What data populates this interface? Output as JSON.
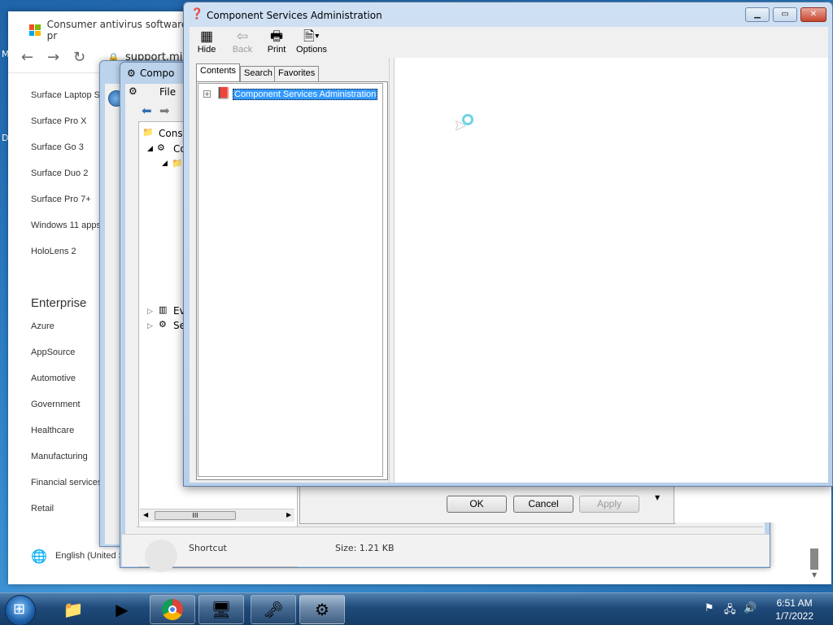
{
  "browser": {
    "tab_title": "Consumer antivirus software pr",
    "address": "support.mi",
    "side_links": [
      "Surface Laptop St",
      "Surface Pro X",
      "Surface Go 3",
      "Surface Duo 2",
      "Surface Pro 7+",
      "Windows 11 apps",
      "HoloLens 2"
    ],
    "enterprise_heading": "Enterprise",
    "enterprise_links": [
      "Azure",
      "AppSource",
      "Automotive",
      "Government",
      "Healthcare",
      "Manufacturing",
      "Financial services",
      "Retail"
    ],
    "language": "English (United S",
    "footer_shortcut": "Shortcut",
    "footer_size": "Size: 1.21 KB"
  },
  "desktop": {
    "left_letter_1": "M",
    "left_letter_2": "D"
  },
  "mmc_back": {
    "title": "Compo",
    "menu_file": "File",
    "tree": [
      "Conso",
      "Co",
      "Ev",
      "Se"
    ],
    "scroll_mark": "III"
  },
  "props_dialog": {
    "ok": "OK",
    "cancel": "Cancel",
    "apply": "Apply"
  },
  "help": {
    "title": "Component Services Administration",
    "toolbar": {
      "hide": "Hide",
      "back": "Back",
      "print": "Print",
      "options": "Options"
    },
    "tabs": {
      "contents": "Contents",
      "search": "Search",
      "favorites": "Favorites"
    },
    "tree_root": "Component Services Administration",
    "expander": "+"
  },
  "taskbar": {
    "time": "6:51 AM",
    "date": "1/7/2022"
  },
  "colors": {
    "selection": "#3399ff",
    "taskbar": "#1f4a7a"
  }
}
